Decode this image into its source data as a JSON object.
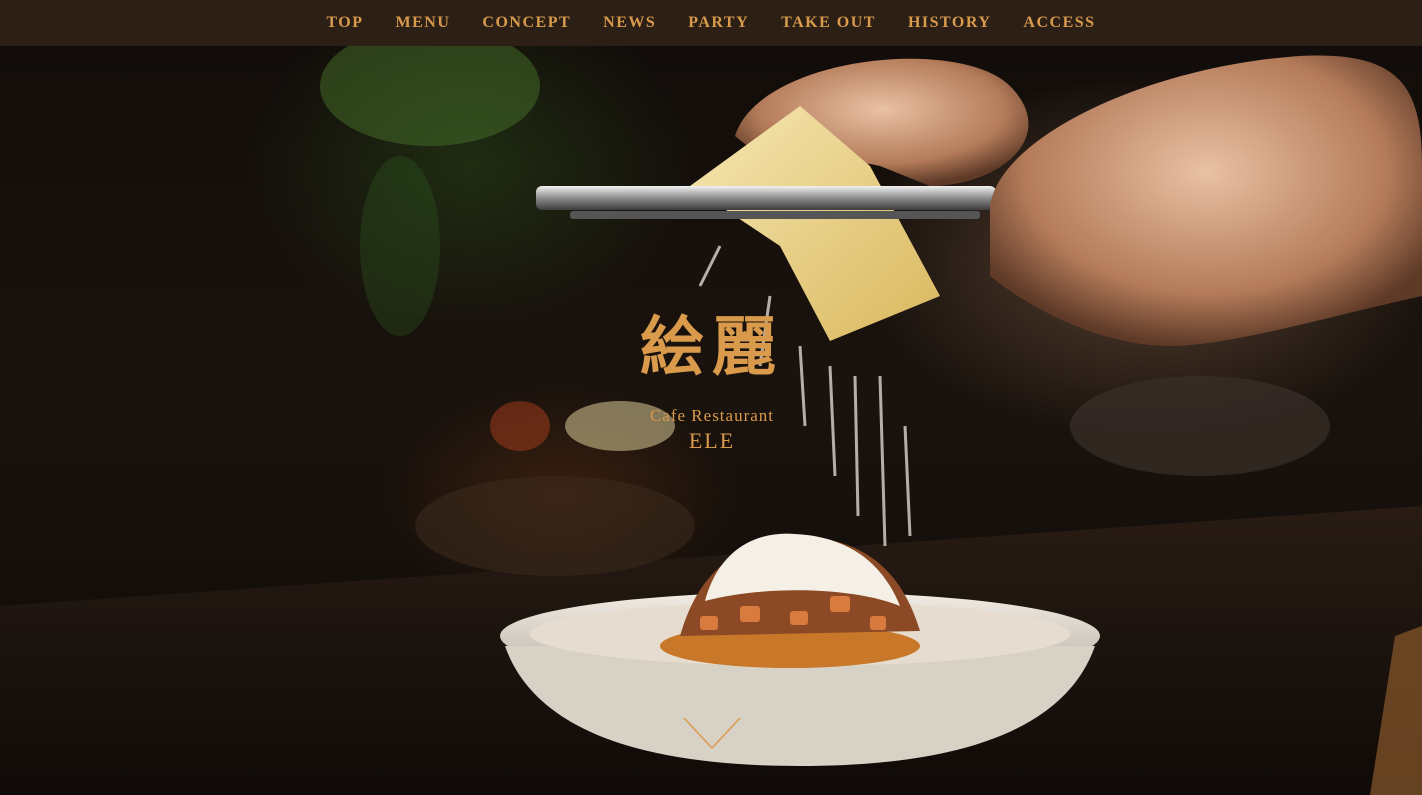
{
  "nav": {
    "items": [
      "TOP",
      "MENU",
      "CONCEPT",
      "NEWS",
      "PARTY",
      "TAKE OUT",
      "HISTORY",
      "ACCESS"
    ]
  },
  "logo": {
    "mark": "絵麗",
    "subtitle": "Cafe Restaurant",
    "name": "ELE"
  },
  "colors": {
    "accent": "#d99a4c",
    "nav_bg": "#2b1f16"
  },
  "icons": {
    "scroll_down": "chevron-down-icon"
  }
}
